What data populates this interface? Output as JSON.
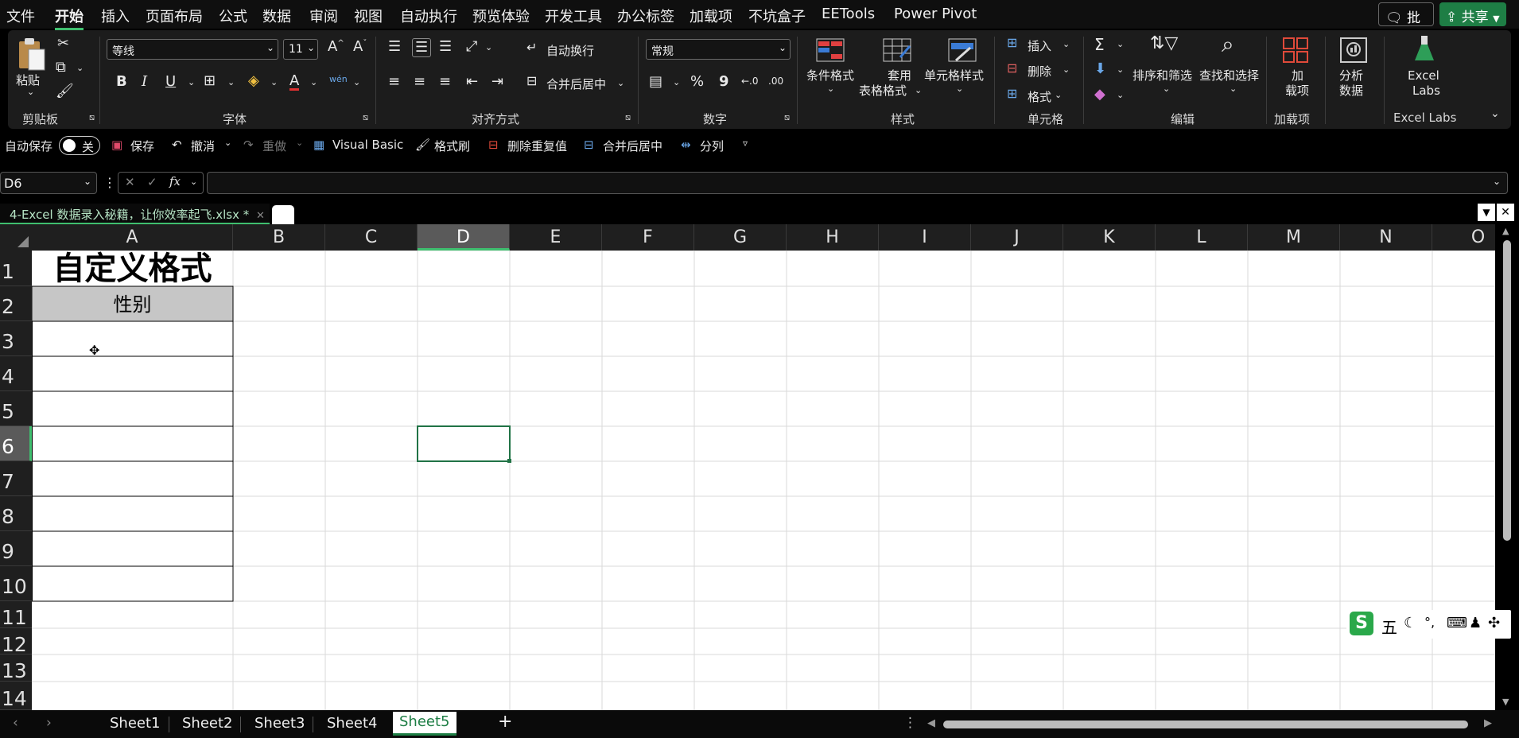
{
  "menu": {
    "items": [
      "文件",
      "开始",
      "插入",
      "页面布局",
      "公式",
      "数据",
      "审阅",
      "视图",
      "自动执行",
      "预览体验",
      "开发工具",
      "办公标签",
      "加载项",
      "不坑盒子",
      "EETools",
      "Power Pivot"
    ],
    "active": "开始",
    "comment_label": "批注",
    "share_label": "共享"
  },
  "ribbon": {
    "clipboard": {
      "paste_label": "粘贴",
      "group_label": "剪贴板"
    },
    "font": {
      "font_name": "等线",
      "font_size": "11",
      "group_label": "字体",
      "bold": "B",
      "italic": "I",
      "underline": "U",
      "phonetic": "wén"
    },
    "alignment": {
      "wrap_label": "自动换行",
      "merge_label": "合并后居中",
      "group_label": "对齐方式"
    },
    "number": {
      "format": "常规",
      "group_label": "数字",
      "percent": "%",
      "comma": "9"
    },
    "styles": {
      "conditional_label": "条件格式",
      "table_label_1": "套用",
      "table_label_2": "表格格式",
      "cell_style_label": "单元格样式",
      "group_label": "样式"
    },
    "cells": {
      "insert_label": "插入",
      "delete_label": "删除",
      "format_label": "格式",
      "group_label": "单元格"
    },
    "editing": {
      "sort_label": "排序和筛选",
      "find_label": "查找和选择",
      "group_label": "编辑"
    },
    "addins": {
      "label_1": "加",
      "label_2": "载项",
      "group_label": "加载项"
    },
    "analyze": {
      "label_1": "分析",
      "label_2": "数据"
    },
    "excel_labs": {
      "label_1": "Excel",
      "label_2": "Labs",
      "group_label": "Excel Labs"
    }
  },
  "qat": {
    "autosave_label": "自动保存",
    "toggle_label": "关",
    "save_label": "保存",
    "undo_label": "撤消",
    "redo_label": "重做",
    "vb_label": "Visual Basic",
    "format_painter_label": "格式刷",
    "remove_dup_label": "删除重复值",
    "merge_center_label": "合并后居中",
    "split_label": "分列"
  },
  "formula_bar": {
    "name_box": "D6",
    "fx": "fx",
    "value": ""
  },
  "document_tab": {
    "title": "4-Excel 数据录入秘籍，让你效率起飞.xlsx *"
  },
  "grid": {
    "columns": [
      "A",
      "B",
      "C",
      "D",
      "E",
      "F",
      "G",
      "H",
      "I",
      "J",
      "K",
      "L",
      "M",
      "N",
      "O"
    ],
    "selected_column": "D",
    "rows": [
      "1",
      "2",
      "3",
      "4",
      "5",
      "6",
      "7",
      "8",
      "9",
      "10",
      "11",
      "12",
      "13",
      "14"
    ],
    "selected_row": "6",
    "cells": {
      "A1": "自定义格式",
      "A2": "性别"
    }
  },
  "sheets": {
    "tabs": [
      "Sheet1",
      "Sheet2",
      "Sheet3",
      "Sheet4",
      "Sheet5"
    ],
    "active": "Sheet5",
    "add": "+"
  },
  "ime": {
    "mode": "五"
  },
  "colors": {
    "accent_green": "#1e7e45",
    "header_fill": "#c6c6c6",
    "selection_border": "#217346"
  }
}
